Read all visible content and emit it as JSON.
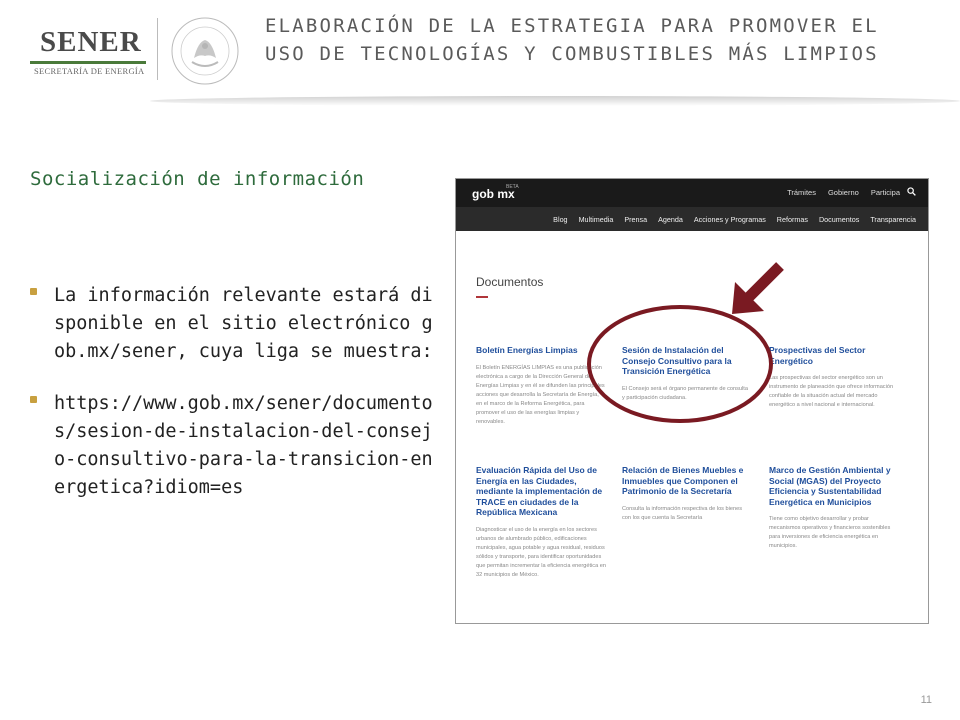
{
  "header": {
    "logo_text": "SENER",
    "logo_subtitle": "SECRETARÍA DE ENERGÍA",
    "seal_text": "ESTADOS UNIDOS MEXICANOS",
    "title_line1": "ELABORACIÓN DE LA ESTRATEGIA PARA PROMOVER EL",
    "title_line2": "USO DE TECNOLOGÍAS Y COMBUSTIBLES MÁS LIMPIOS"
  },
  "section_title": "Socialización de información",
  "bullets": [
    "La información relevante estará disponible en el sitio electrónico gob.mx/sener, cuya liga se muestra:",
    "https://www.gob.mx/sener/documentos/sesion-de-instalacion-del-consejo-consultivo-para-la-transicion-energetica?idiom=es"
  ],
  "screenshot": {
    "brand": "gob mx",
    "beta": "BETA",
    "top_links": [
      "Trámites",
      "Gobierno",
      "Participa"
    ],
    "sub_links": [
      "Blog",
      "Multimedia",
      "Prensa",
      "Agenda",
      "Acciones y Programas",
      "Reformas",
      "Documentos",
      "Transparencia"
    ],
    "doc_heading": "Documentos",
    "cards": [
      {
        "title": "Boletín Energías Limpias",
        "body": "El Boletín ENERGÍAS LIMPIAS es una publicación electrónica a cargo de la Dirección General de Energías Limpias y en él se difunden las principales acciones que desarrolla la Secretaría de Energía, en el marco de la Reforma Energética, para promover el uso de las energías limpias y renovables."
      },
      {
        "title": "Sesión de Instalación del Consejo Consultivo para la Transición Energética",
        "body": "El Consejo será el órgano permanente de consulta y participación ciudadana."
      },
      {
        "title": "Prospectivas del Sector Energético",
        "body": "Las prospectivas del sector energético son un instrumento de planeación que ofrece información confiable de la situación actual del mercado energético a nivel nacional e internacional."
      },
      {
        "title": "Evaluación Rápida del Uso de Energía en las Ciudades, mediante la implementación de TRACE en ciudades de la República Mexicana",
        "body": "Diagnosticar el uso de la energía en los sectores urbanos de alumbrado público, edificaciones municipales, agua potable y agua residual, residuos sólidos y transporte, para identificar oportunidades que permitan incrementar la eficiencia energética en 32 municipios de México."
      },
      {
        "title": "Relación de Bienes Muebles e Inmuebles que Componen el Patrimonio de la Secretaría",
        "body": "Consulta la información respectiva de los bienes con los que cuenta la Secretaría"
      },
      {
        "title": "Marco de Gestión Ambiental y Social (MGAS) del Proyecto Eficiencia y Sustentabilidad Energética en Municipios",
        "body": "Tiene como objetivo desarrollar y probar mecanismos operativos y financieros sostenibles para inversiones de eficiencia energética en municipios."
      }
    ]
  },
  "colors": {
    "accent_green": "#2e6b3c",
    "annotation_red": "#7a1a22",
    "bullet": "#c8a040",
    "link_blue": "#1f4e9b"
  },
  "page_number": "11"
}
